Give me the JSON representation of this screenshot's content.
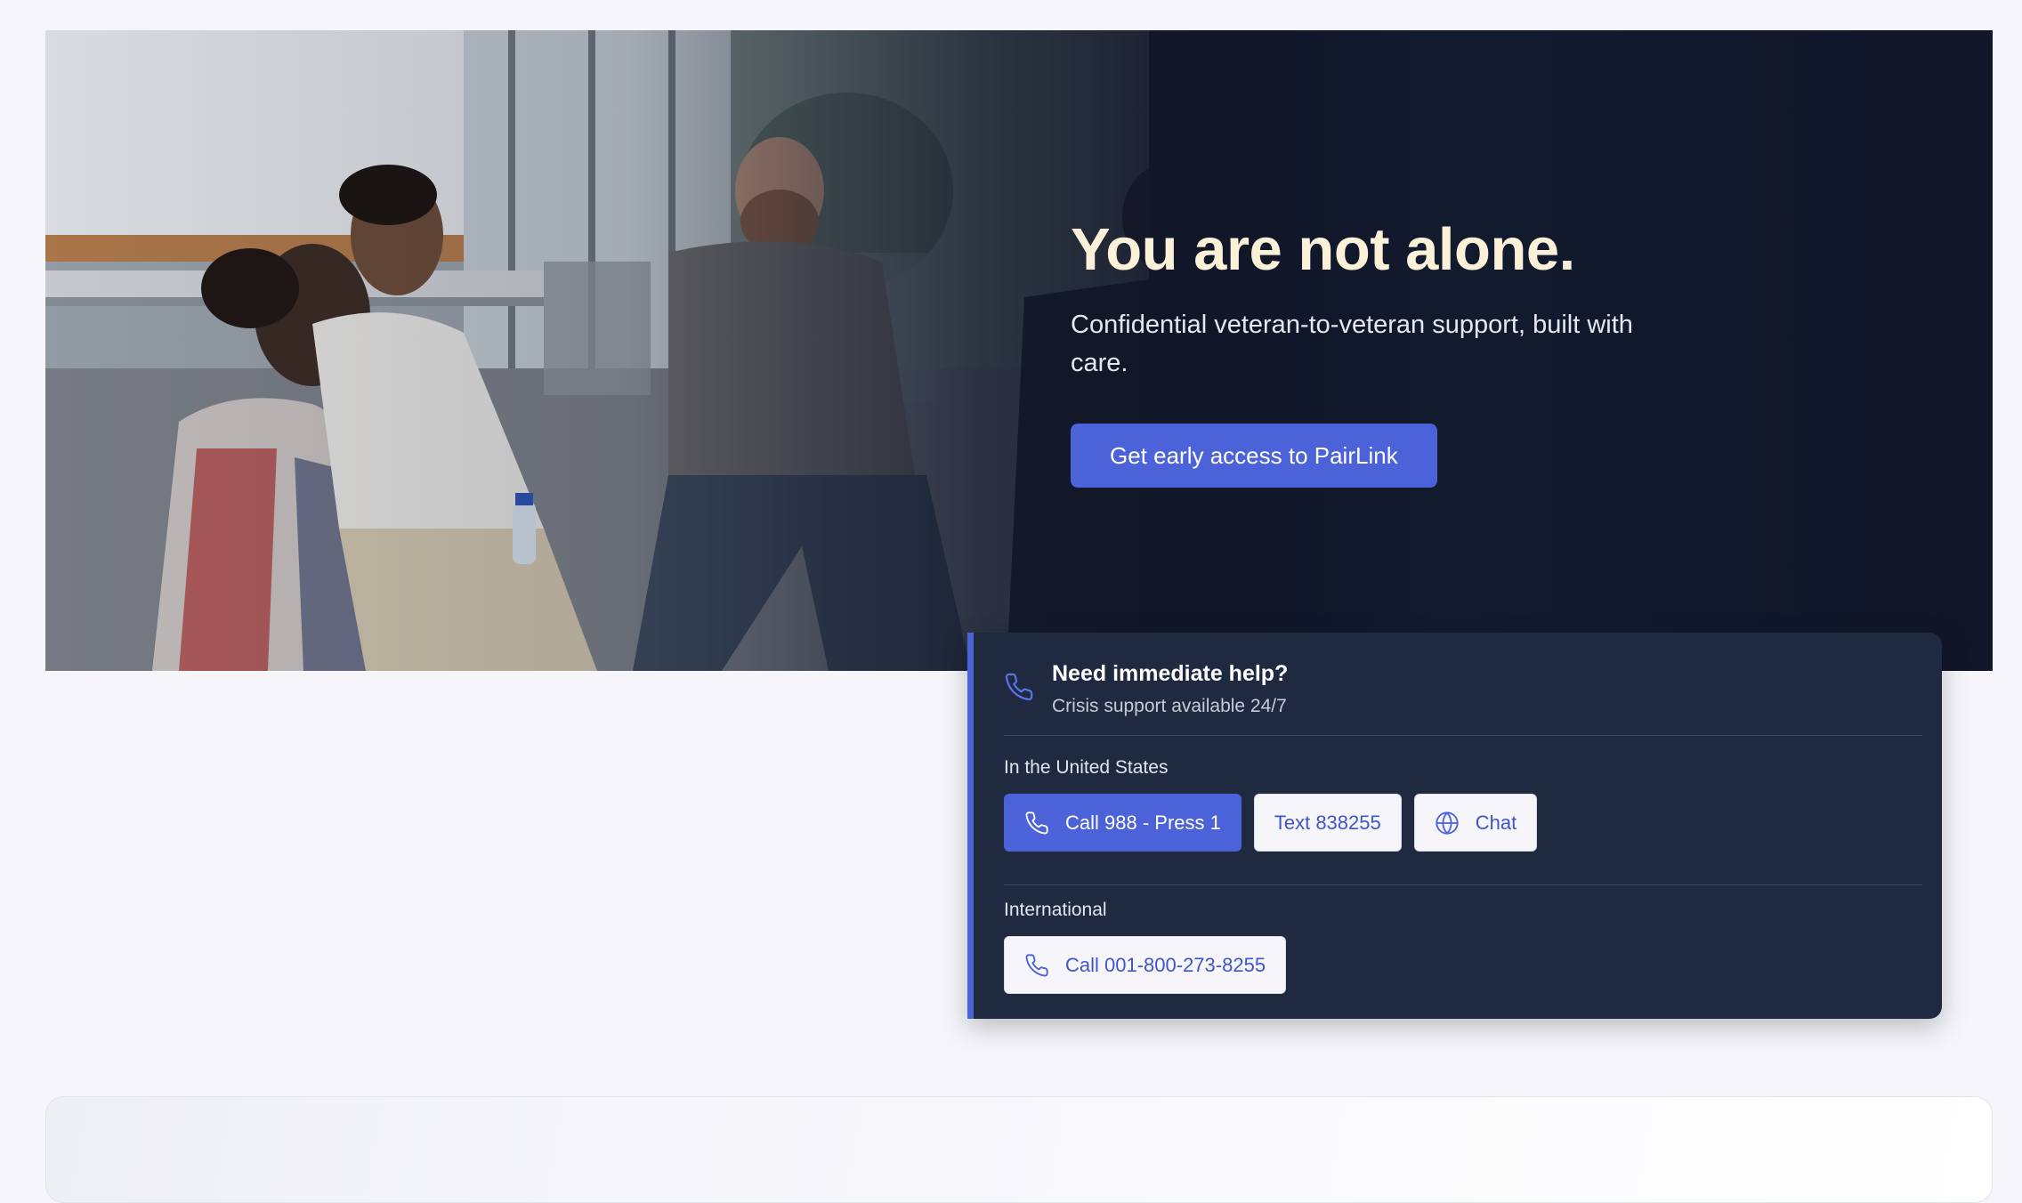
{
  "hero": {
    "title_first": "You are not alone.",
    "subtitle": "Confidential veteran-to-veteran support, built with care.",
    "cta_label": "Get early access to PairLink",
    "photo_alt": "Group of veterans sitting in a support circle"
  },
  "crisis": {
    "title": "Need immediate help?",
    "subtitle": "Crisis support available 24/7",
    "us_label": "In the United States",
    "us_buttons": [
      {
        "label": "Call 988 - Press 1",
        "icon": "phone-icon"
      },
      {
        "label": "Text 838255"
      },
      {
        "label": "Chat",
        "icon": "globe-icon"
      }
    ],
    "intl_label": "International",
    "intl_buttons": [
      {
        "label": "Call 001-800-273-8255",
        "icon": "phone-icon"
      }
    ]
  },
  "colors": {
    "accent": "#4b62d8",
    "panel": "#1f2940",
    "hero_bg": "#121a2e",
    "page_bg": "#f6f6fa",
    "title_highlight": "#fbf1d9"
  }
}
